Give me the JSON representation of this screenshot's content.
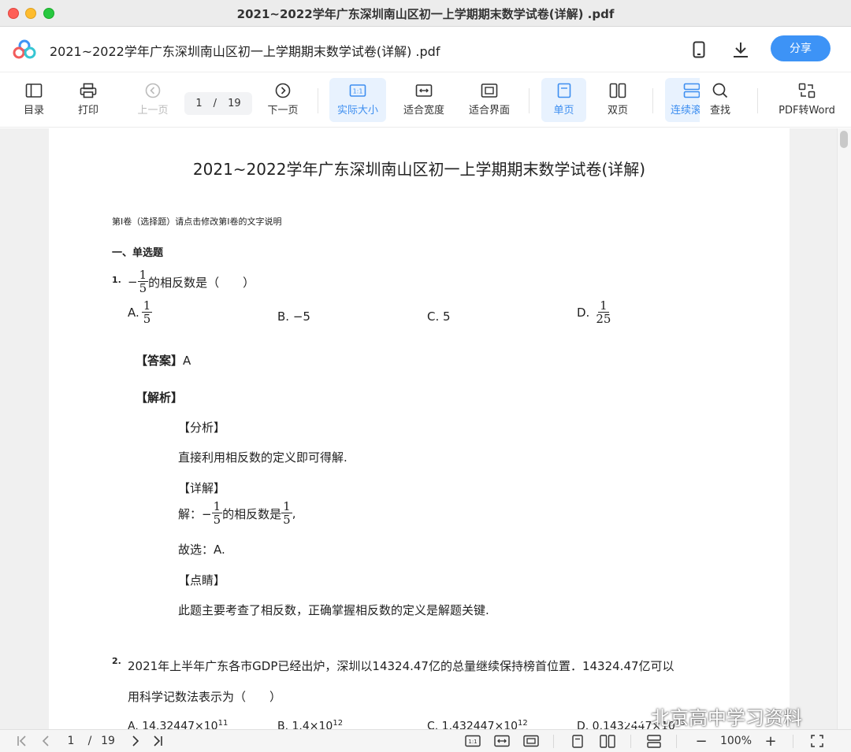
{
  "window": {
    "title": "2021~2022学年广东深圳南山区初一上学期期末数学试卷(详解) .pdf"
  },
  "header": {
    "doc_title": "2021~2022学年广东深圳南山区初一上学期期末数学试卷(详解) .pdf",
    "share_label": "分享",
    "icons": [
      "app-logo-icon",
      "phone-icon",
      "download-icon"
    ]
  },
  "toolbar": {
    "toc": "目录",
    "print": "打印",
    "prev": "上一页",
    "next": "下一页",
    "current_page": "1",
    "page_sep": "/",
    "total_pages": "19",
    "actual_size": "实际大小",
    "fit_width": "适合宽度",
    "fit_page": "适合界面",
    "single_page": "单页",
    "double_page": "双页",
    "continuous": "连续滚",
    "find": "查找",
    "pdf_to_word": "PDF转Word"
  },
  "document": {
    "title": "2021~2022学年广东深圳南山区初一上学期期末数学试卷(详解)",
    "part_note": "第I卷（选择题）请点击修改第I卷的文字说明",
    "section": "一、单选题",
    "q1": {
      "num": "1.",
      "minus": "−",
      "frac_num": "1",
      "frac_den": "5",
      "stem": "的相反数是（　　）",
      "a_label": "A.",
      "a_num": "1",
      "a_den": "5",
      "b": "B. −5",
      "c": "C. 5",
      "d_label": "D.",
      "d_num": "1",
      "d_den": "25",
      "answer_tag": "【答案】",
      "answer": "A",
      "analysis_tag": "【解析】",
      "fenxi_tag": "【分析】",
      "fenxi": "直接利用相反数的定义即可得解.",
      "xiangjie_tag": "【详解】",
      "sol_prefix": "解：−",
      "sol_mid": "的相反数是",
      "sol_end": ",",
      "choice": "故选：A.",
      "dianjing_tag": "【点睛】",
      "dianjing": "此题主要考查了相反数，正确掌握相反数的定义是解题关键."
    },
    "q2": {
      "num": "2.",
      "line1": "2021年上半年广东各市GDP已经出炉，深圳以14324.47亿的总量继续保持榜首位置．14324.47亿可以",
      "line2": "用科学记数法表示为（　　）",
      "a": "A. 14.32447×10",
      "a_exp": "11",
      "b": "B. 1.4×10",
      "b_exp": "12",
      "c": "C. 1.432447×10",
      "c_exp": "12",
      "d": "D. 0.1432447×10",
      "d_exp": "13"
    }
  },
  "statusbar": {
    "current_page": "1",
    "sep": "/",
    "total_pages": "19",
    "zoom": "100%",
    "minus": "−",
    "plus": "+"
  },
  "watermark": {
    "text": "北京高中学习资料"
  },
  "colors": {
    "accent": "#3d93f6",
    "active_bg": "#e8f2fe",
    "titlebar": "#ececec"
  }
}
